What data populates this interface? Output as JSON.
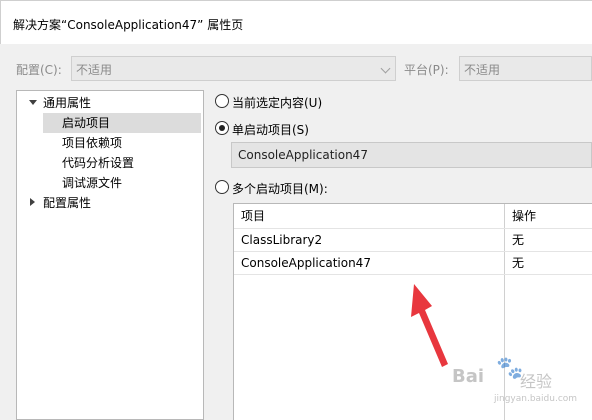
{
  "window": {
    "title": "解决方案“ConsoleApplication47” 属性页"
  },
  "config_bar": {
    "config_label": "配置(C):",
    "config_value": "不适用",
    "platform_label": "平台(P):",
    "platform_value": "不适用"
  },
  "tree": {
    "items": [
      {
        "label": "通用属性"
      },
      {
        "label": "启动项目"
      },
      {
        "label": "项目依赖项"
      },
      {
        "label": "代码分析设置"
      },
      {
        "label": "调试源文件"
      },
      {
        "label": "配置属性"
      }
    ]
  },
  "startup": {
    "radio_current": "当前选定内容(U)",
    "radio_single": "单启动项目(S)",
    "single_value": "ConsoleApplication47",
    "radio_multiple": "多个启动项目(M):"
  },
  "grid": {
    "columns": [
      "项目",
      "操作"
    ],
    "rows": [
      {
        "project": "ClassLibrary2",
        "action": "无"
      },
      {
        "project": "ConsoleApplication47",
        "action": "无"
      }
    ]
  },
  "watermark": {
    "logo": "Bai",
    "paw": "🐾",
    "sub": "经验",
    "url": "jingyan.baidu.com"
  },
  "colors": {
    "arrow": "#e8373e",
    "selected_row": "#dcdcdc"
  }
}
